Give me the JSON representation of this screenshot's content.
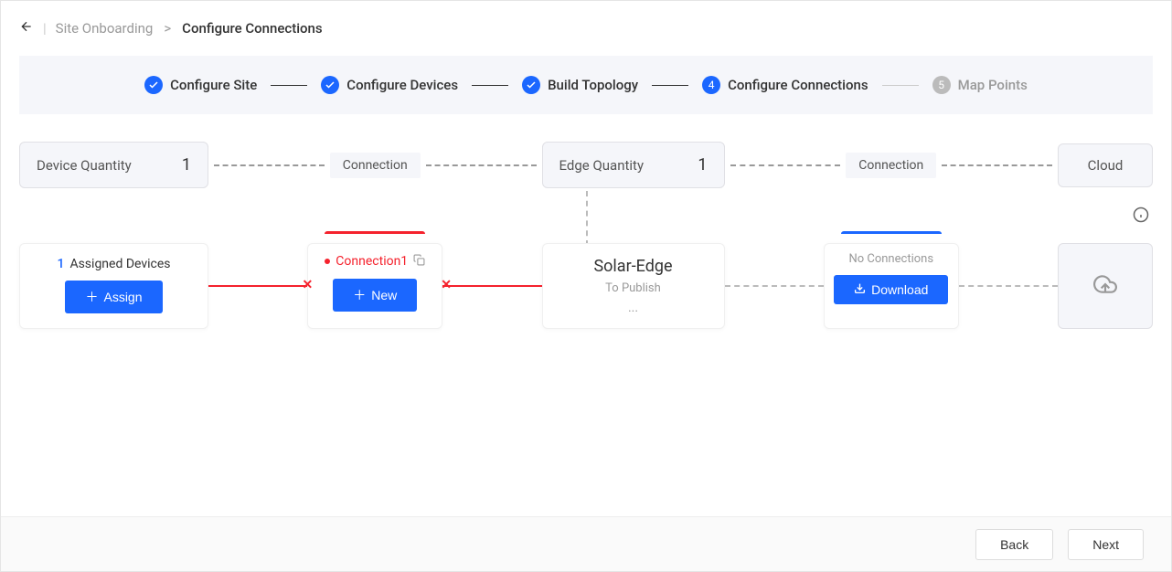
{
  "breadcrumb": {
    "parent": "Site Onboarding",
    "current": "Configure Connections"
  },
  "stepper": {
    "steps": [
      {
        "label": "Configure Site",
        "state": "done"
      },
      {
        "label": "Configure Devices",
        "state": "done"
      },
      {
        "label": "Build Topology",
        "state": "done"
      },
      {
        "label": "Configure Connections",
        "state": "current",
        "num": "4"
      },
      {
        "label": "Map Points",
        "state": "pending",
        "num": "5"
      }
    ]
  },
  "summary": {
    "device_quantity_label": "Device Quantity",
    "device_quantity": "1",
    "connection_label": "Connection",
    "edge_quantity_label": "Edge Quantity",
    "edge_quantity": "1",
    "cloud_label": "Cloud"
  },
  "flow": {
    "assigned": {
      "count": "1",
      "label": "Assigned Devices",
      "button": "Assign"
    },
    "connection1": {
      "label": "Connection1",
      "button": "New"
    },
    "edge": {
      "name": "Solar-Edge",
      "status": "To Publish",
      "more": "..."
    },
    "no_connections": {
      "label": "No Connections",
      "button": "Download"
    }
  },
  "footer": {
    "back": "Back",
    "next": "Next"
  },
  "icons": {
    "check": "✓",
    "plus": "+",
    "download": "↓"
  }
}
